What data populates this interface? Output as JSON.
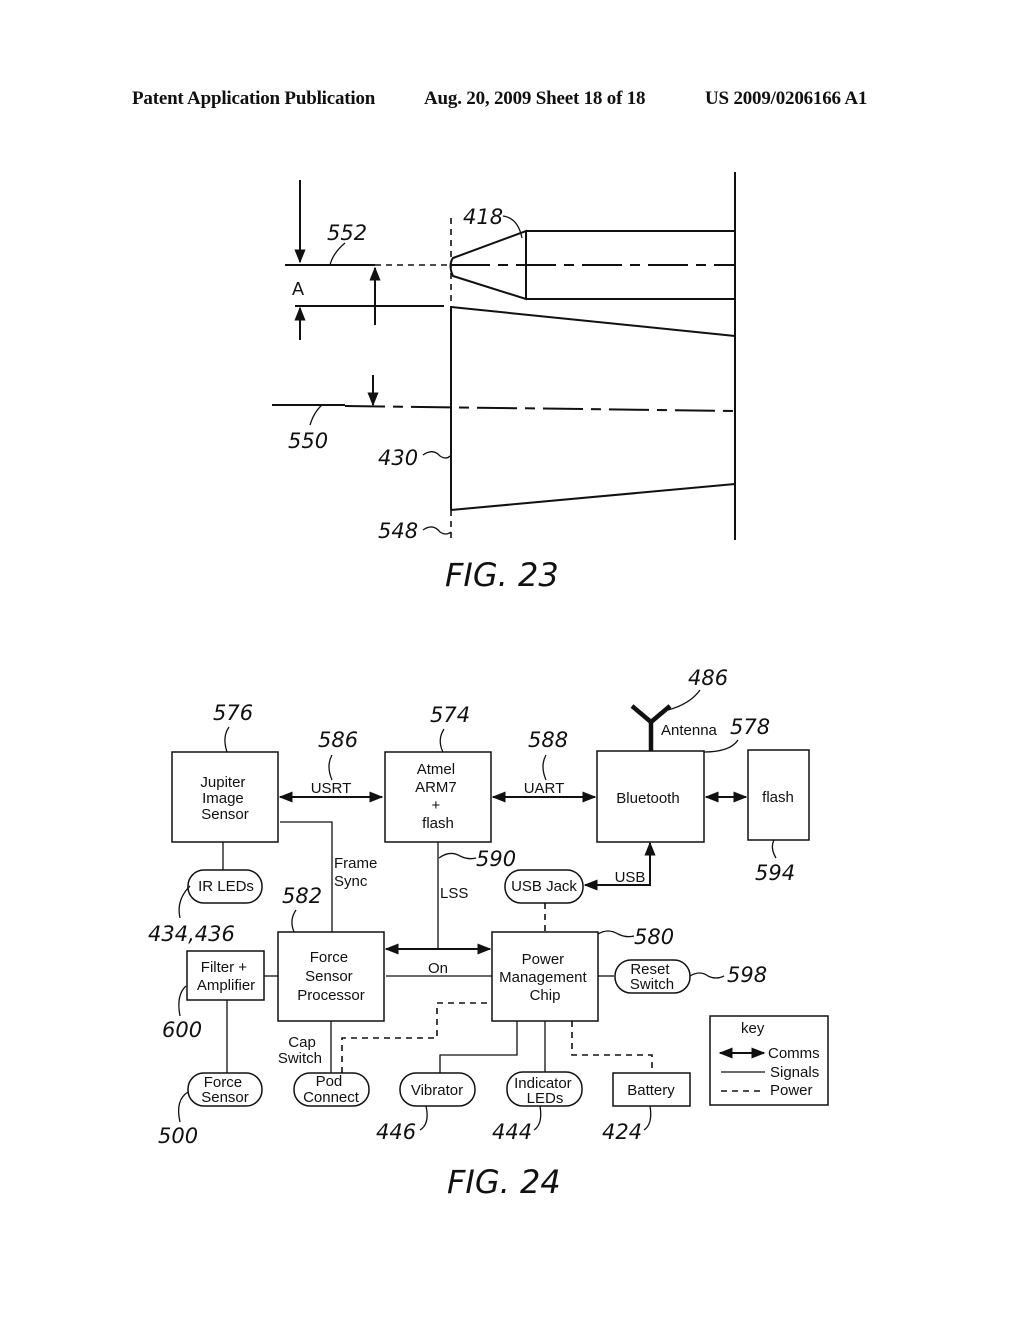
{
  "header": {
    "publication": "Patent Application Publication",
    "date_sheet": "Aug. 20, 2009  Sheet 18 of 18",
    "number": "US 2009/0206166 A1"
  },
  "fig23": {
    "caption": "FIG. 23",
    "dimension_label": "A",
    "refs": {
      "r552": "552",
      "r418": "418",
      "r550": "550",
      "r430": "430",
      "r548": "548"
    }
  },
  "fig24": {
    "caption": "FIG. 24",
    "blocks": {
      "jupiter": [
        "Jupiter",
        "Image",
        "Sensor"
      ],
      "atmel": [
        "Atmel",
        "ARM7",
        "+",
        "flash"
      ],
      "bluetooth": "Bluetooth",
      "flash": "flash",
      "force_processor": [
        "Force",
        "Sensor",
        "Processor"
      ],
      "power_chip": [
        "Power",
        "Management",
        "Chip"
      ],
      "filter": [
        "Filter +",
        "Amplifier"
      ],
      "battery": "Battery"
    },
    "pills": {
      "ir_leds": "IR LEDs",
      "usb_jack": "USB Jack",
      "reset_switch": [
        "Reset",
        "Switch"
      ],
      "force_sensor": [
        "Force",
        "Sensor"
      ],
      "pod_connect": [
        "Pod",
        "Connect"
      ],
      "vibrator": "Vibrator",
      "indicator_leds": [
        "Indicator",
        "LEDs"
      ]
    },
    "signals": {
      "usrt": "USRT",
      "uart": "UART",
      "usb": "USB",
      "frame_sync": [
        "Frame",
        "Sync"
      ],
      "lss": "LSS",
      "on": "On",
      "cap_switch": [
        "Cap",
        "Switch"
      ],
      "antenna": "Antenna"
    },
    "refs": {
      "r576": "576",
      "r586": "586",
      "r574": "574",
      "r588": "588",
      "r486": "486",
      "r578": "578",
      "r594": "594",
      "r590": "590",
      "r582": "582",
      "r580": "580",
      "r598": "598",
      "r434": "434,436",
      "r600": "600",
      "r500": "500",
      "r446": "446",
      "r444": "444",
      "r424": "424"
    },
    "key": {
      "title": "key",
      "items": [
        "Comms",
        "Signals",
        "Power"
      ]
    }
  }
}
